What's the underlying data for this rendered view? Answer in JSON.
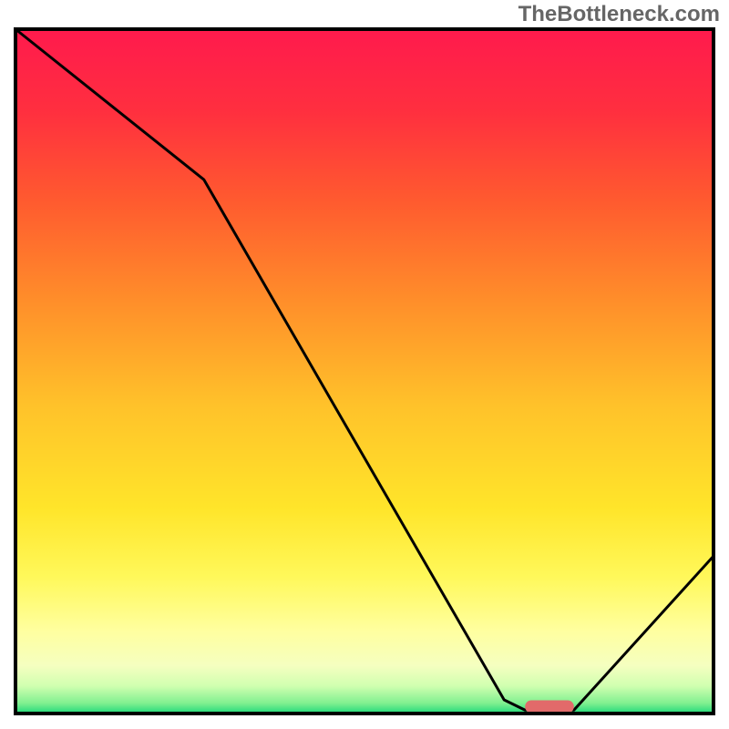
{
  "watermark": "TheBottleneck.com",
  "chart_data": {
    "type": "line",
    "title": "",
    "xlabel": "",
    "ylabel": "",
    "xlim": [
      0,
      100
    ],
    "ylim": [
      0,
      100
    ],
    "curve_points": [
      {
        "x": 0,
        "y": 100
      },
      {
        "x": 27,
        "y": 78
      },
      {
        "x": 70,
        "y": 2
      },
      {
        "x": 73,
        "y": 0.5
      },
      {
        "x": 80,
        "y": 0.5
      },
      {
        "x": 100,
        "y": 23
      }
    ],
    "marker": {
      "x_start": 73,
      "x_end": 80,
      "y": 1
    },
    "gradient_stops": [
      {
        "offset": 0.0,
        "color": "#ff1a4d"
      },
      {
        "offset": 0.12,
        "color": "#ff2f3f"
      },
      {
        "offset": 0.25,
        "color": "#ff5a2f"
      },
      {
        "offset": 0.4,
        "color": "#ff8f2a"
      },
      {
        "offset": 0.55,
        "color": "#ffc22a"
      },
      {
        "offset": 0.7,
        "color": "#ffe52a"
      },
      {
        "offset": 0.8,
        "color": "#fff85a"
      },
      {
        "offset": 0.88,
        "color": "#ffffa0"
      },
      {
        "offset": 0.93,
        "color": "#f5ffc0"
      },
      {
        "offset": 0.96,
        "color": "#d0ffb0"
      },
      {
        "offset": 0.985,
        "color": "#80f090"
      },
      {
        "offset": 1.0,
        "color": "#1fd97a"
      }
    ],
    "curve_color": "#000000",
    "curve_width": 3,
    "marker_color": "#e26a6a",
    "frame_color": "#000000",
    "frame_width": 4
  }
}
